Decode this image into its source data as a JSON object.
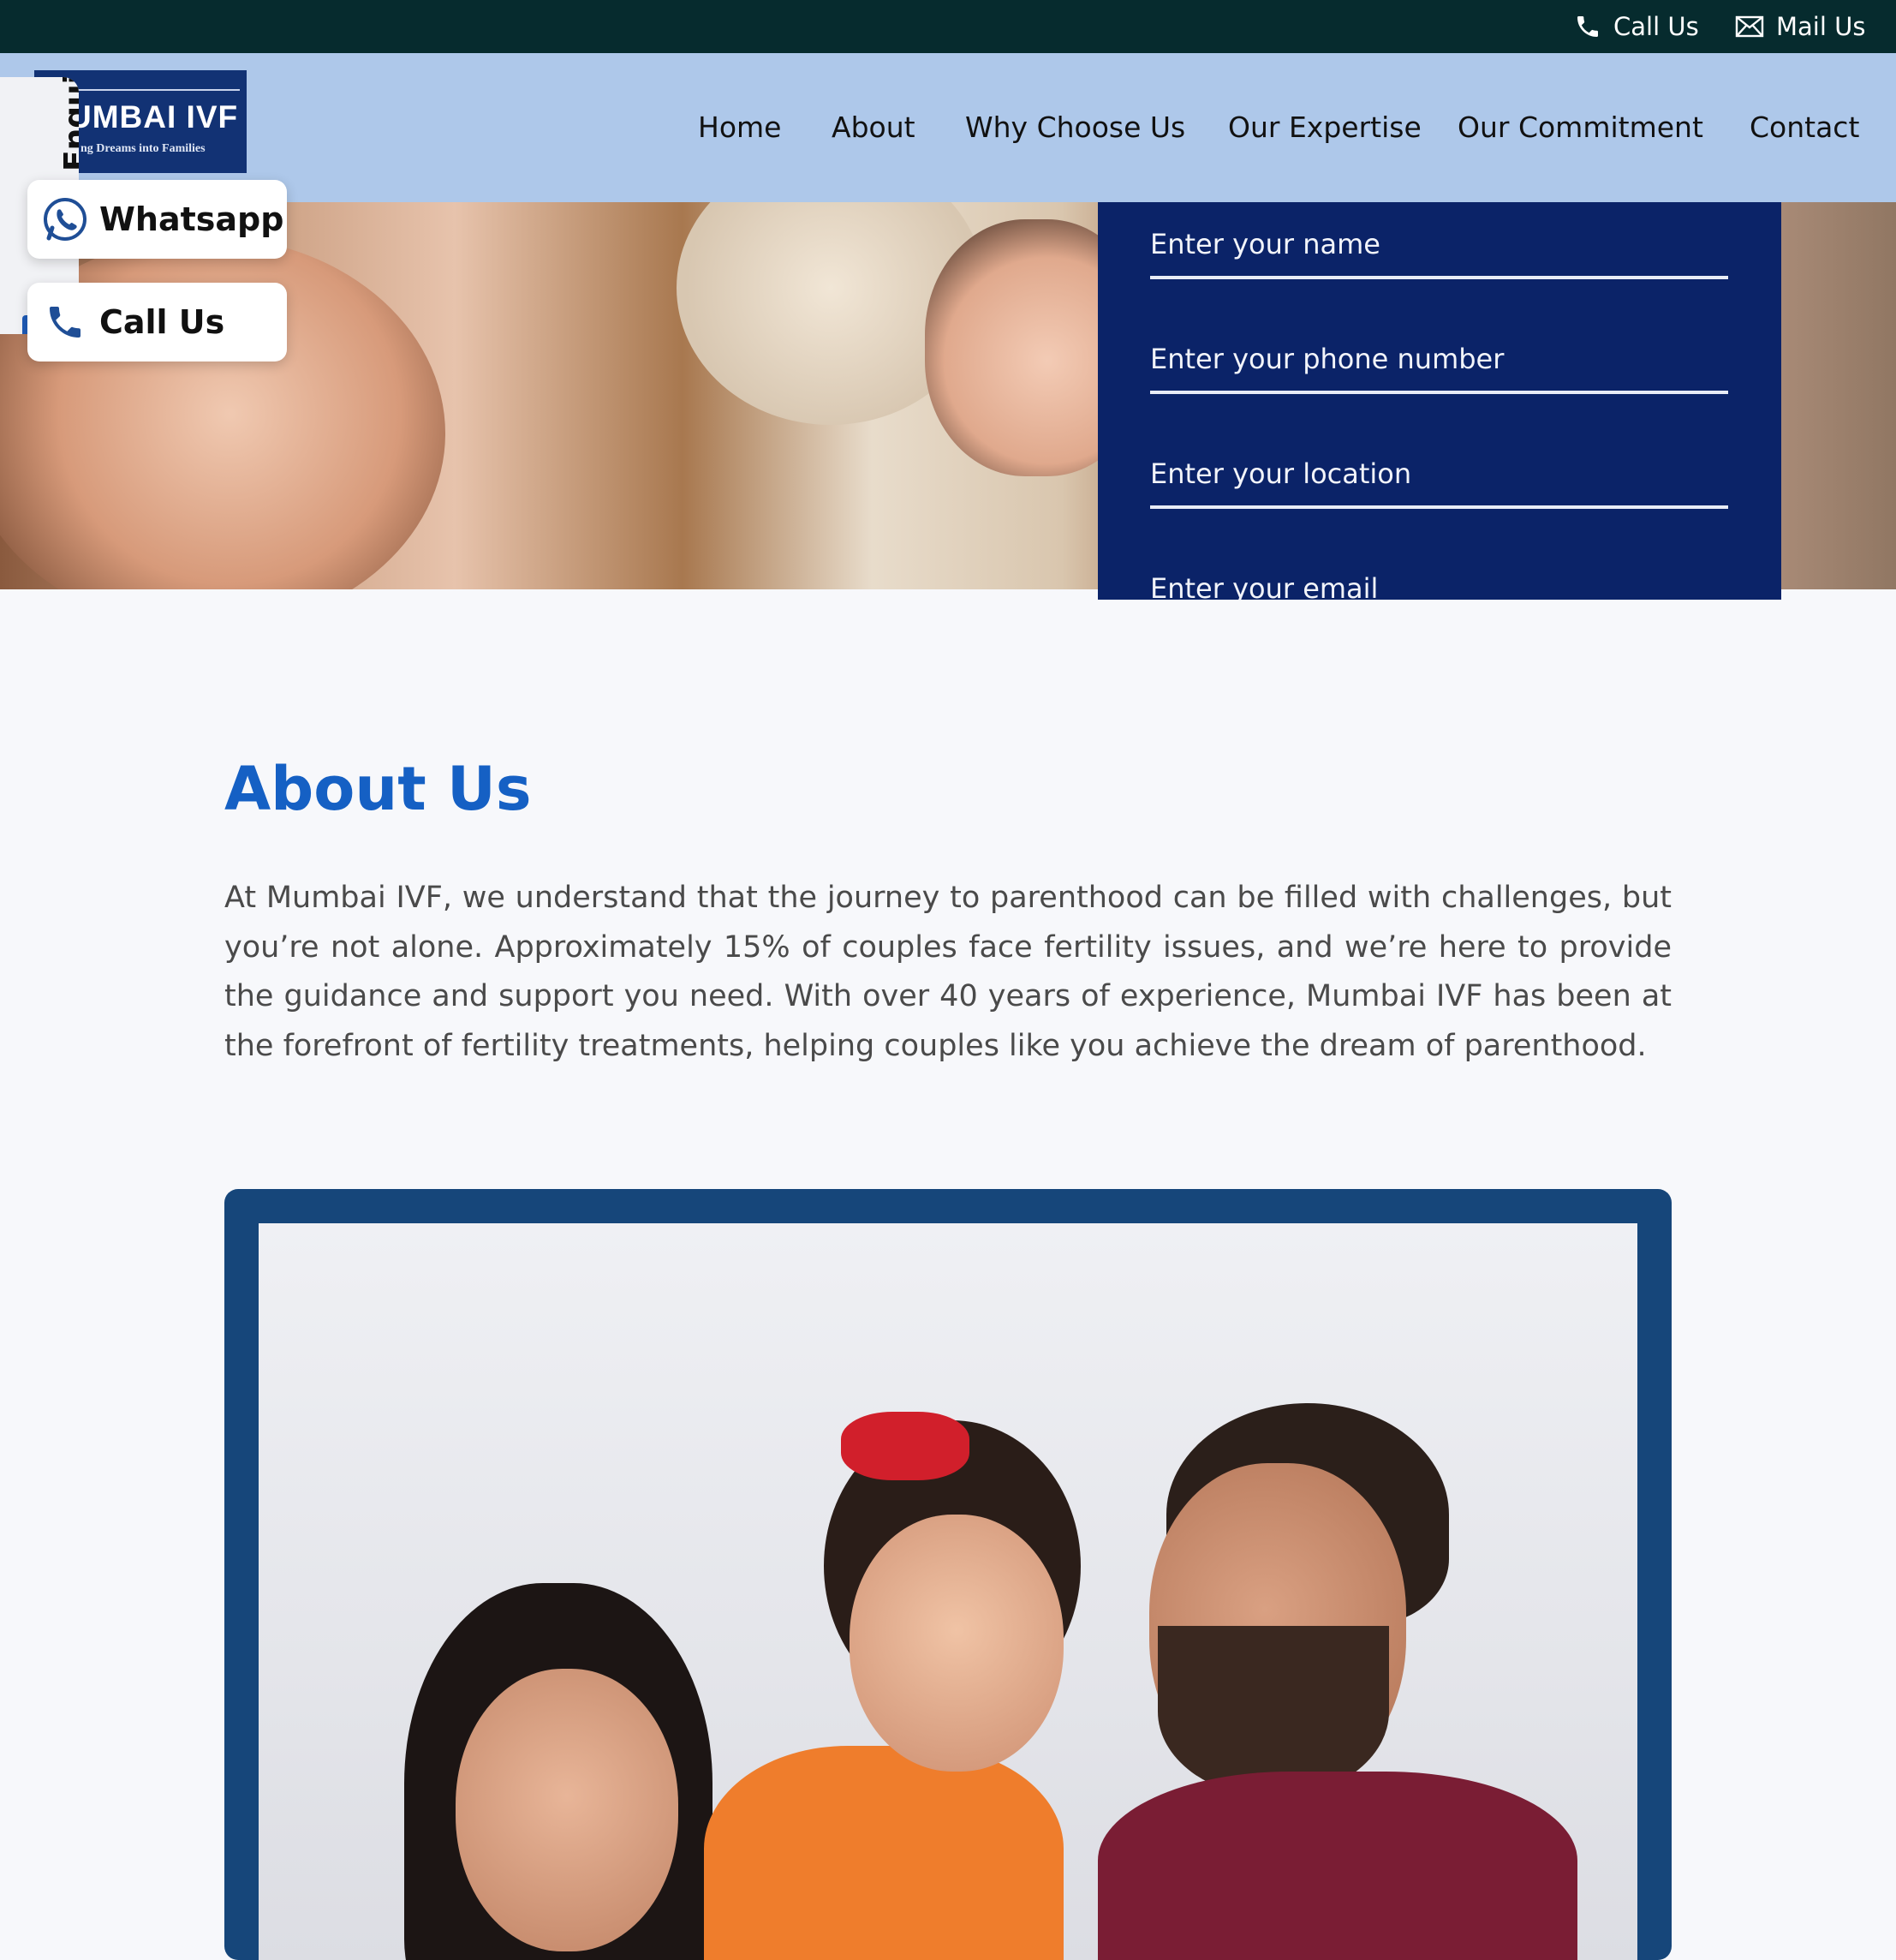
{
  "topbar": {
    "call_label": "Call Us",
    "mail_label": "Mail Us",
    "call_icon": "phone-icon",
    "mail_icon": "envelope-icon"
  },
  "header": {
    "logo_title": "UMBAI IVF",
    "logo_tagline": "ng Dreams into Families",
    "nav": [
      "Home",
      "About",
      "Why Choose Us",
      "Our Expertise",
      "Our Commitment",
      "Contact"
    ]
  },
  "floating": {
    "enquire_label": "Enquire Now",
    "whatsapp_label": "Whatsapp",
    "call_label": "Call Us",
    "whatsapp_icon": "whatsapp-icon",
    "call_icon": "phone-icon"
  },
  "form": {
    "name_placeholder": "Enter your name",
    "phone_placeholder": "Enter your phone number",
    "location_placeholder": "Enter your location",
    "email_placeholder": "Enter your email"
  },
  "about": {
    "title": "About Us",
    "text": "At Mumbai IVF, we understand that the journey to parenthood can be filled with challenges, but you’re not alone. Approximately 15% of couples face fertility issues, and we’re here to provide the guidance and support you need. With over 40 years of experience, Mumbai IVF has been at the forefront of fertility treatments, helping couples like you achieve the dream of parenthood."
  },
  "colors": {
    "topbar_bg": "#062b2e",
    "nav_bg": "#aec8ea",
    "form_bg": "#0b2368",
    "accent": "#1560c4",
    "frame": "#16467a"
  }
}
